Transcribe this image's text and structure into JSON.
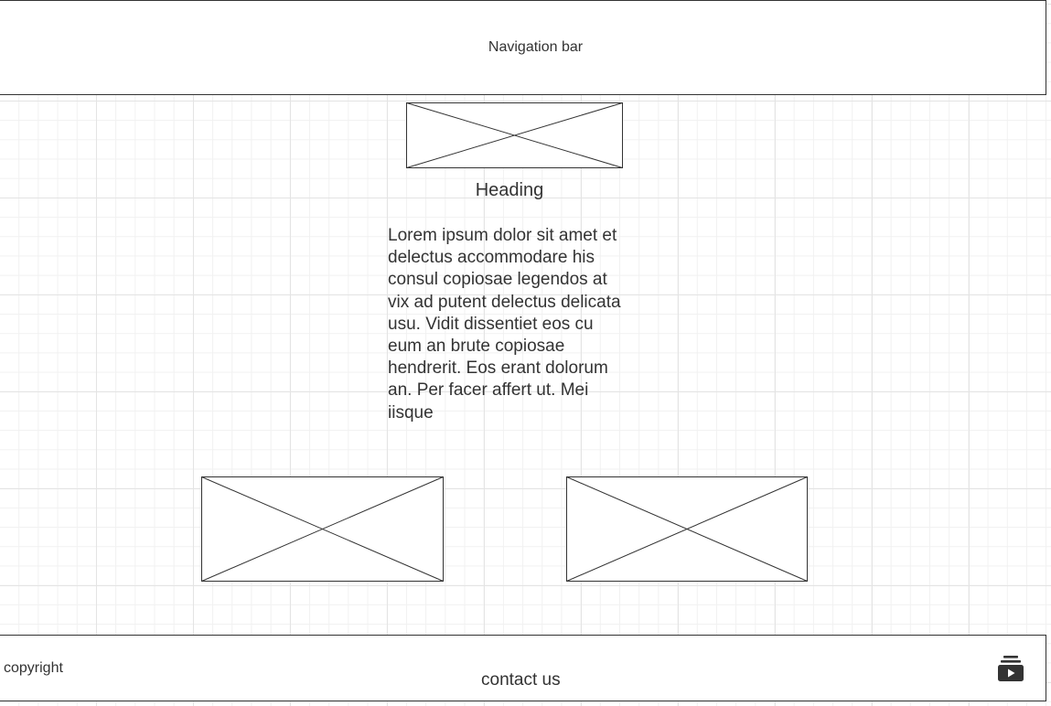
{
  "navbar": {
    "label": "Navigation bar"
  },
  "hero": {
    "image": "image-placeholder",
    "heading": "Heading",
    "body": "Lorem ipsum dolor sit amet et delectus accommodare his consul copiosae legendos at vix ad putent delectus delicata usu. Vidit dissentiet eos cu eum an brute copiosae hendrerit. Eos erant dolorum an. Per facer affert ut. Mei iisque"
  },
  "gallery": {
    "images": [
      "image-placeholder",
      "image-placeholder"
    ]
  },
  "footer": {
    "copyright": "copyright",
    "contact": "contact us",
    "icon": "video-playlist-icon"
  },
  "colors": {
    "stroke": "#333333",
    "grid_major": "#e4e4e4",
    "grid_minor": "#f1f1f1",
    "background": "#ffffff"
  }
}
